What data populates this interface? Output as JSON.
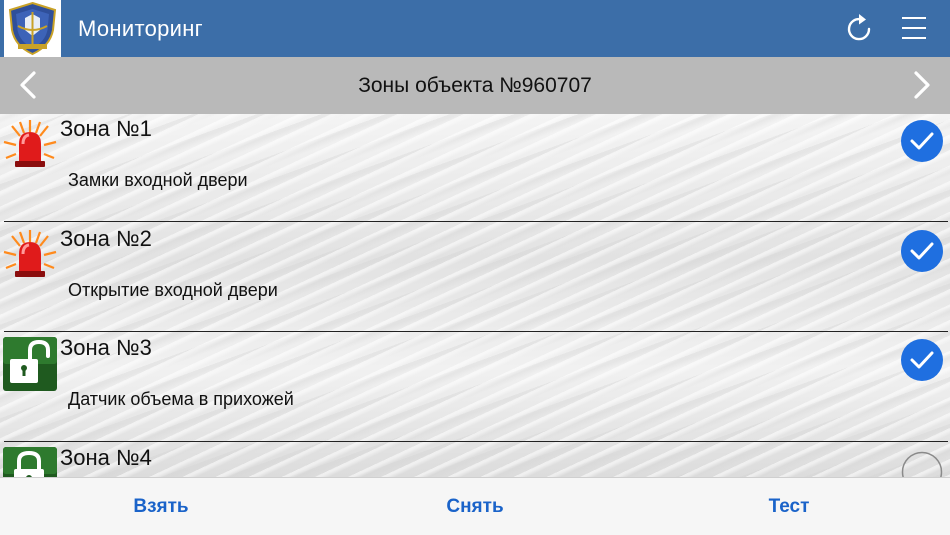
{
  "header": {
    "title": "Мониторинг",
    "logo_icon": "shield-logo-icon",
    "refresh_icon": "refresh-icon",
    "menu_icon": "hamburger-menu-icon",
    "color": "#3c6ea8"
  },
  "navbar": {
    "title": "Зоны объекта №960707",
    "prev_icon": "chevron-left-icon",
    "next_icon": "chevron-right-icon"
  },
  "zones": [
    {
      "title": "Зона №1",
      "description": "Замки входной двери",
      "icon": "alarm-beacon-icon",
      "checked": true
    },
    {
      "title": "Зона №2",
      "description": "Открытие входной двери",
      "icon": "alarm-beacon-icon",
      "checked": true
    },
    {
      "title": "Зона №3",
      "description": "Датчик объема в прихожей",
      "icon": "unlocked-padlock-icon",
      "checked": true
    },
    {
      "title": "Зона №4",
      "description": "",
      "icon": "locked-padlock-icon",
      "checked": false
    }
  ],
  "toolbar": {
    "arm_label": "Взять",
    "disarm_label": "Снять",
    "test_label": "Тест",
    "accent": "#1a63c9"
  },
  "check_color": "#1f6fe0"
}
